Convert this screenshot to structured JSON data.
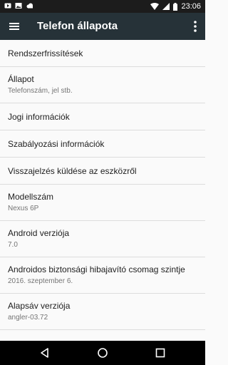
{
  "status_bar": {
    "time": "23:06",
    "icons": [
      "play-store-icon",
      "image-icon",
      "cloud-icon",
      "wifi-icon",
      "signal-icon",
      "battery-icon"
    ]
  },
  "app_bar": {
    "title": "Telefon állapota",
    "background": "#263238"
  },
  "list": {
    "items": [
      {
        "title": "Rendszerfrissítések"
      },
      {
        "title": "Állapot",
        "subtitle": "Telefonszám, jel stb."
      },
      {
        "title": "Jogi információk"
      },
      {
        "title": "Szabályozási információk"
      },
      {
        "title": "Visszajelzés küldése az eszközről"
      },
      {
        "title": "Modellszám",
        "subtitle": "Nexus 6P"
      },
      {
        "title": "Android verziója",
        "subtitle": "7.0"
      },
      {
        "title": "Androidos biztonsági hibajavító csomag szintje",
        "subtitle": "2016. szeptember 6."
      },
      {
        "title": "Alapsáv verziója",
        "subtitle": "angler-03.72"
      }
    ]
  },
  "nav_bar": {
    "buttons": [
      "back-icon",
      "home-icon",
      "recents-icon"
    ]
  }
}
